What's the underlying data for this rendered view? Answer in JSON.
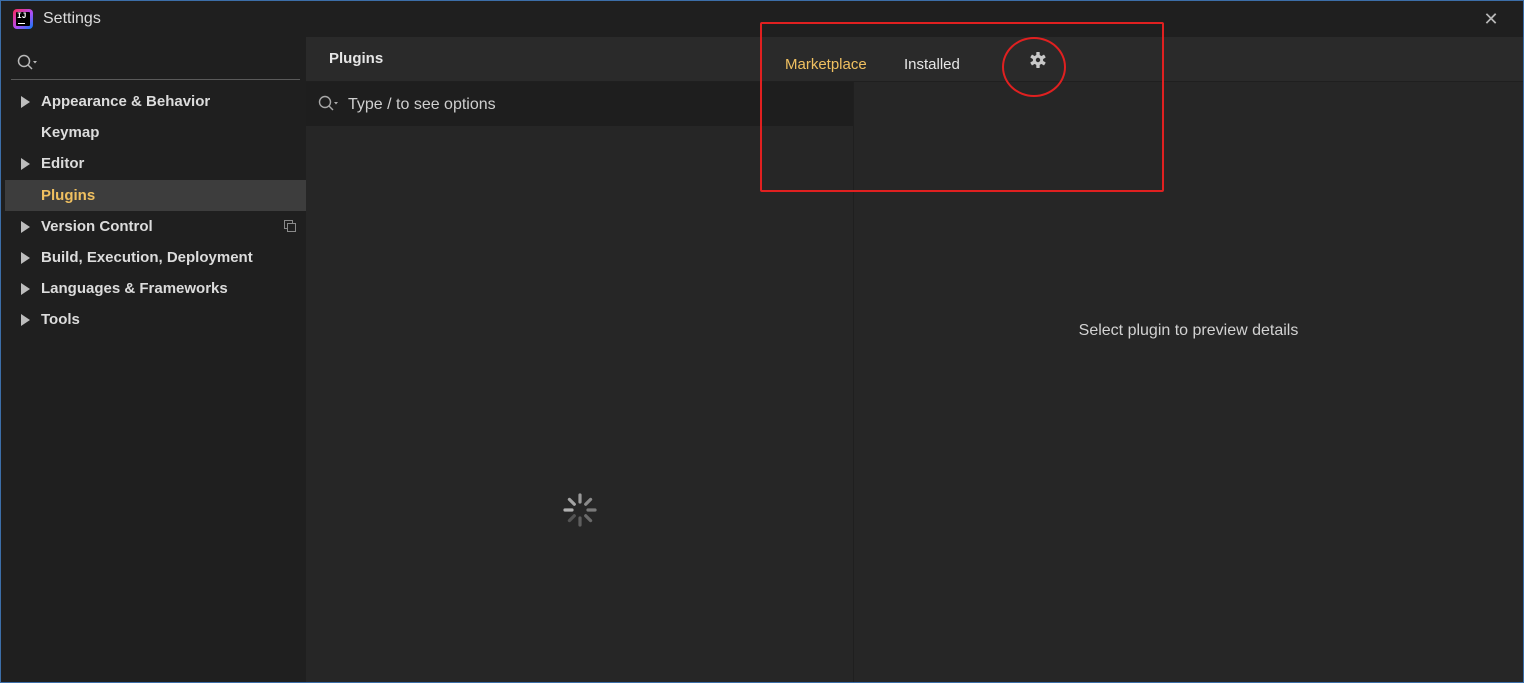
{
  "window": {
    "title": "Settings",
    "close_glyph": "✕"
  },
  "sidebar": {
    "search_placeholder": "",
    "items": [
      {
        "label": "Appearance & Behavior",
        "expandable": true
      },
      {
        "label": "Keymap",
        "expandable": false
      },
      {
        "label": "Editor",
        "expandable": true
      },
      {
        "label": "Plugins",
        "expandable": false,
        "selected": true
      },
      {
        "label": "Version Control",
        "expandable": true,
        "icon": "copy-icon"
      },
      {
        "label": "Build, Execution, Deployment",
        "expandable": true
      },
      {
        "label": "Languages & Frameworks",
        "expandable": true
      },
      {
        "label": "Tools",
        "expandable": true
      }
    ]
  },
  "main": {
    "title": "Plugins",
    "tabs": [
      {
        "label": "Marketplace",
        "active": true
      },
      {
        "label": "Installed",
        "active": false
      }
    ],
    "settings_icon": "gear-icon",
    "search": {
      "placeholder": "Type / to see options",
      "value": ""
    },
    "detail_empty": "Select plugin to preview details"
  },
  "colors": {
    "accent": "#f0c060",
    "annotation": "#e02020",
    "selected_bg": "#3d3d3d"
  }
}
